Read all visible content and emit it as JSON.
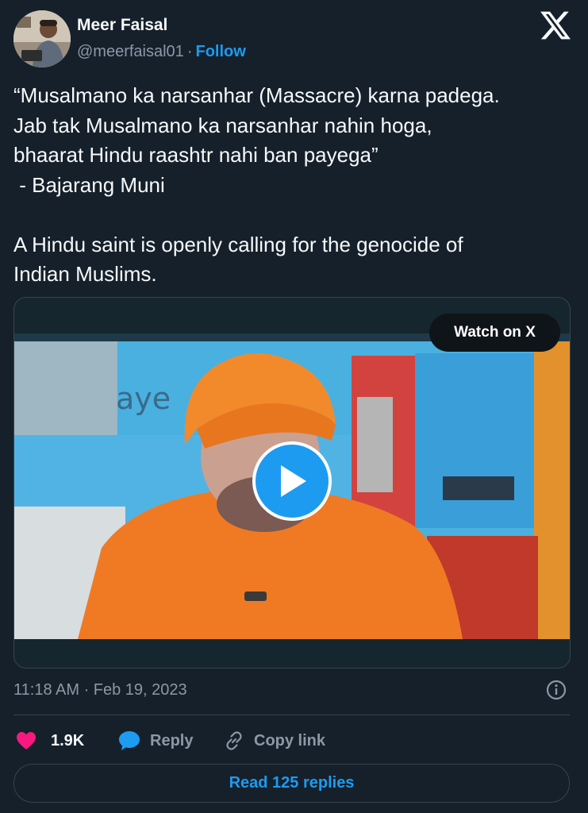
{
  "user": {
    "name": "Meer Faisal",
    "handle": "@meerfaisal01",
    "separator": "·",
    "follow_label": "Follow"
  },
  "tweet": {
    "lines": [
      "“Musalmano ka narsanhar (Massacre) karna padega.",
      "Jab tak Musalmano ka narsanhar nahin hoga,",
      "bhaarat Hindu raashtr nahi ban payega”",
      " - Bajarang Muni",
      "A Hindu saint is openly calling for the genocide of",
      "Indian Muslims."
    ]
  },
  "media": {
    "watch_label": "Watch on X",
    "background_text": "aye"
  },
  "meta": {
    "timestamp": "11:18 AM · Feb 19, 2023"
  },
  "actions": {
    "like_count": "1.9K",
    "reply_label": "Reply",
    "copy_label": "Copy link",
    "read_replies_label": "Read 125 replies"
  },
  "colors": {
    "background": "#15202b",
    "accent": "#1d9bf0",
    "like": "#f91880",
    "muted_text": "#8b98a5",
    "border": "#38444d"
  },
  "icons": [
    "x-logo-icon",
    "play-icon",
    "info-icon",
    "heart-icon",
    "reply-bubble-icon",
    "link-icon"
  ]
}
